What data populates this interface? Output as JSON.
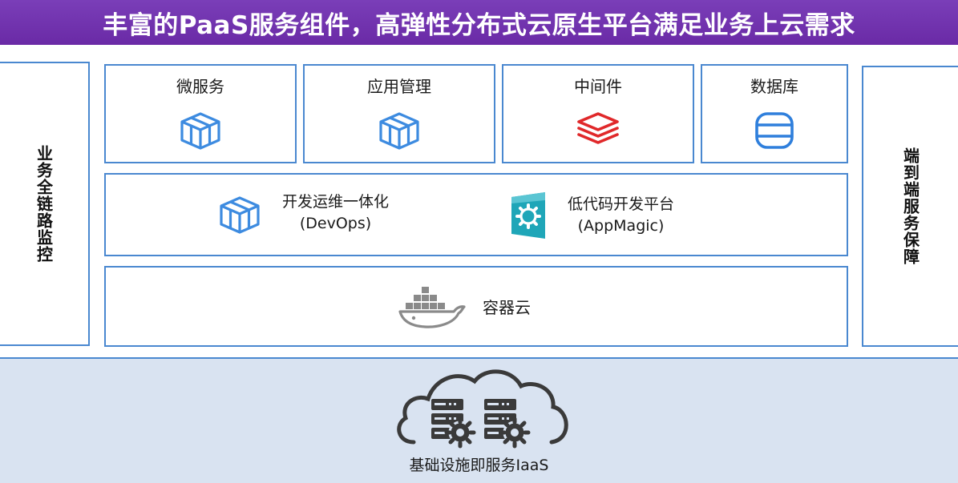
{
  "banner": {
    "title": "丰富的PaaS服务组件，高弹性分布式云原生平台满足业务上云需求"
  },
  "left_panel": {
    "label": "业务全链路监控"
  },
  "right_panel": {
    "label": "端到端服务保障"
  },
  "services": [
    {
      "label": "微服务",
      "icon": "cube-icon",
      "color": "#3d8be0"
    },
    {
      "label": "应用管理",
      "icon": "cube-icon",
      "color": "#3d8be0"
    },
    {
      "label": "中间件",
      "icon": "layers-icon",
      "color": "#e0282a"
    },
    {
      "label": "数据库",
      "icon": "database-icon",
      "color": "#2f7fdc"
    }
  ],
  "devops": {
    "line1": "开发运维一体化",
    "line2": "(DevOps)",
    "icon": "cube-icon"
  },
  "appmagic": {
    "line1": "低代码开发平台",
    "line2": "(AppMagic)",
    "icon": "gear-tile-icon",
    "color": "#1fa6b8"
  },
  "container": {
    "label": "容器云",
    "icon": "docker-whale-icon"
  },
  "iaas": {
    "label": "基础设施即服务IaaS",
    "icon": "cloud-server-icon"
  },
  "colors": {
    "banner": "#6a2aa6",
    "border": "#4a88d0",
    "iaas_bg": "#d9e3f1"
  }
}
